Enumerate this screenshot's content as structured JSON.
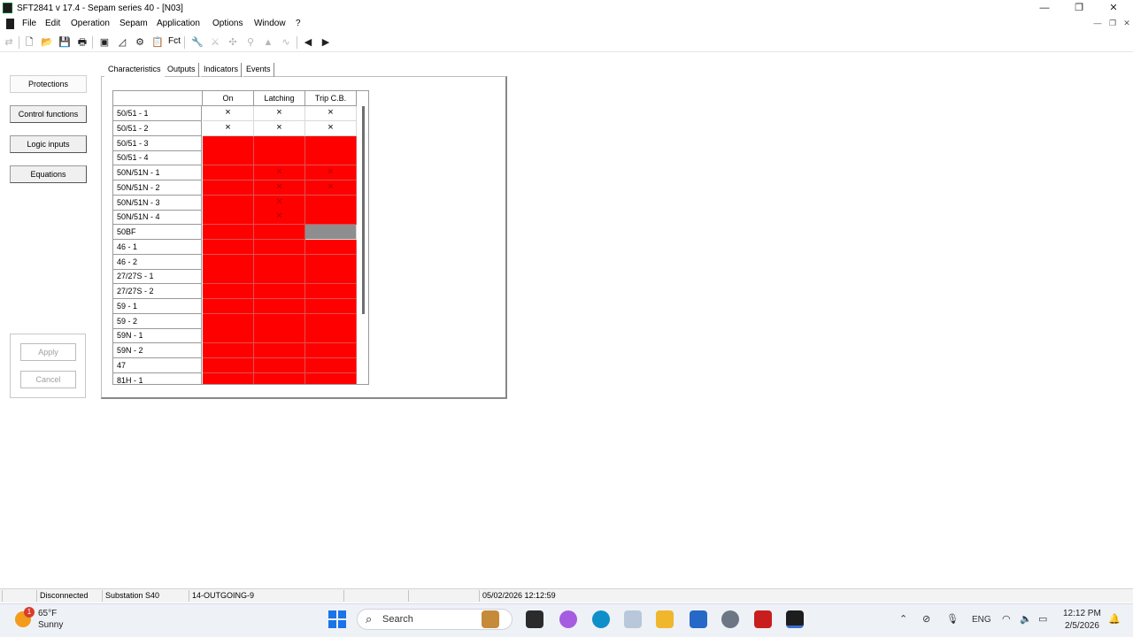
{
  "window": {
    "title": "SFT2841  v 17.4 - Sepam series 40 - [N03]",
    "controls": [
      "—",
      "❐",
      "✕"
    ]
  },
  "menu": [
    "File",
    "Edit",
    "Operation",
    "Sepam",
    "Application",
    "Options",
    "Window",
    "?"
  ],
  "toolbar": {
    "fct_label": "Fct"
  },
  "sidebar": {
    "buttons": [
      "Protections",
      "Control functions",
      "Logic inputs",
      "Equations"
    ],
    "apply": "Apply",
    "cancel": "Cancel"
  },
  "tabs": [
    "Characteristics",
    "Outputs",
    "Indicators",
    "Events"
  ],
  "grid": {
    "columns": [
      "On",
      "Latching",
      "Trip C.B."
    ],
    "rows": [
      {
        "label": "50/51 - 1",
        "cells": [
          "white-x",
          "white-x",
          "white-x"
        ]
      },
      {
        "label": "50/51 - 2",
        "cells": [
          "white-x",
          "white-x",
          "white-x"
        ]
      },
      {
        "label": "50/51 - 3",
        "cells": [
          "red",
          "red",
          "red"
        ]
      },
      {
        "label": "50/51 - 4",
        "cells": [
          "red",
          "red",
          "red"
        ]
      },
      {
        "label": "50N/51N - 1",
        "cells": [
          "red",
          "red-x",
          "red-x"
        ]
      },
      {
        "label": "50N/51N - 2",
        "cells": [
          "red",
          "red-x",
          "red-x"
        ]
      },
      {
        "label": "50N/51N - 3",
        "cells": [
          "red",
          "red-x",
          "red"
        ]
      },
      {
        "label": "50N/51N - 4",
        "cells": [
          "red",
          "red-x",
          "red"
        ]
      },
      {
        "label": "50BF",
        "cells": [
          "red",
          "red",
          "gray"
        ]
      },
      {
        "label": "46 - 1",
        "cells": [
          "red",
          "red",
          "red"
        ]
      },
      {
        "label": "46 - 2",
        "cells": [
          "red",
          "red",
          "red"
        ]
      },
      {
        "label": "27/27S - 1",
        "cells": [
          "red",
          "red",
          "red"
        ]
      },
      {
        "label": "27/27S - 2",
        "cells": [
          "red",
          "red",
          "red"
        ]
      },
      {
        "label": "59 - 1",
        "cells": [
          "red",
          "red",
          "red"
        ]
      },
      {
        "label": "59 - 2",
        "cells": [
          "red",
          "red",
          "red"
        ]
      },
      {
        "label": "59N - 1",
        "cells": [
          "red",
          "red",
          "red"
        ]
      },
      {
        "label": "59N - 2",
        "cells": [
          "red",
          "red",
          "red"
        ]
      },
      {
        "label": "47",
        "cells": [
          "red",
          "red",
          "red"
        ]
      },
      {
        "label": "81H - 1",
        "cells": [
          "red",
          "red",
          "red"
        ]
      }
    ]
  },
  "status": {
    "connection": "Disconnected",
    "substation": "Substation S40",
    "feeder": "14-OUTGOING-9",
    "datetime": "05/02/2026  12:12:59"
  },
  "taskbar": {
    "weather_temp": "65°F",
    "weather_cond": "Sunny",
    "weather_badge": "1",
    "search": "Search",
    "lang": "ENG",
    "time": "12:12 PM",
    "date": "2/5/2026"
  },
  "colors": {
    "disabled_cell": "#ff0000",
    "unavailable_cell": "#8e8e8e",
    "accent": "#1a73e8"
  }
}
